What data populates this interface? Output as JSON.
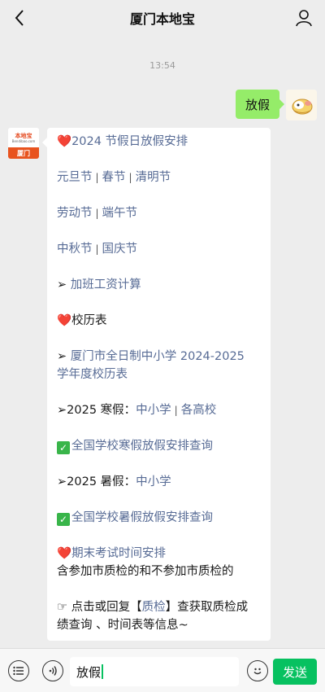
{
  "header": {
    "title": "厦门本地宝"
  },
  "chat": {
    "time": "13:54",
    "outgoing_message": "放假",
    "bot_avatar": {
      "logo_text": "本地宝",
      "site_text": "Bendibao.com",
      "city": "厦门"
    },
    "reply": {
      "holiday_heading": "2024 节假日放假安排",
      "holidays_row1": [
        "元旦节",
        "春节",
        "清明节"
      ],
      "holidays_row2": [
        "劳动节",
        "端午节"
      ],
      "holidays_row3": [
        "中秋节",
        "国庆节"
      ],
      "overtime_arrow": "➢",
      "overtime_link": "加班工资计算",
      "calendar_heading": "校历表",
      "calendar_arrow": "➢",
      "calendar_link_line1": "厦门市全日制中小学 2024-2025",
      "calendar_link_line2": "学年度校历表",
      "winter_label": "➢2025 寒假：",
      "winter_links": [
        "中小学",
        "各高校"
      ],
      "winter_query": "全国学校寒假放假安排查询",
      "summer_label": "➢2025 暑假：",
      "summer_link": "中小学",
      "summer_query": "全国学校暑假放假安排查询",
      "exam_heading": "期末考试时间安排",
      "exam_desc": "含参加市质检的和不参加市质检的",
      "tip_prefix": "☞ 点击或回复【",
      "tip_keyword": "质检",
      "tip_suffix_line1": "】查获取质检成",
      "tip_line2": "绩查询 、时间表等信息~"
    }
  },
  "composer": {
    "input_value": "放假",
    "send_label": "发送"
  },
  "colors": {
    "link": "#576b95",
    "send": "#07c160",
    "outgoing_bubble": "#95ec69"
  }
}
